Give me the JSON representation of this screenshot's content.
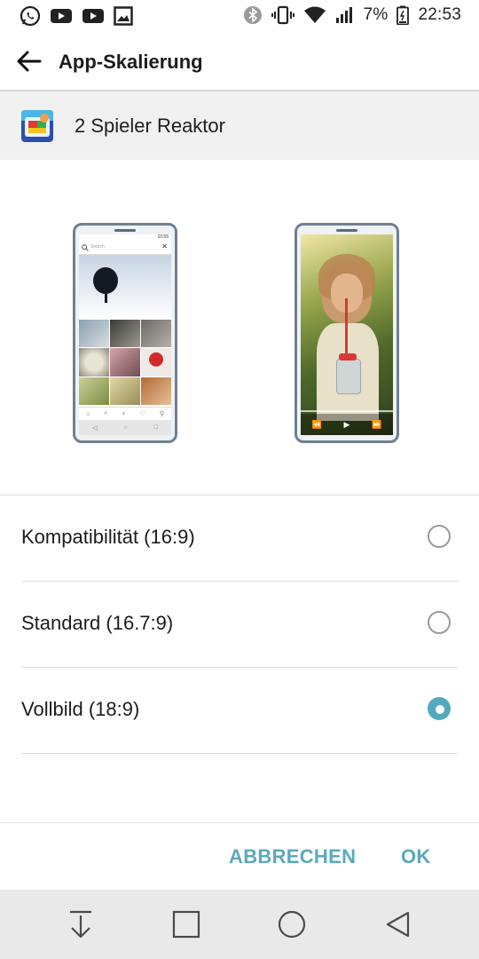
{
  "status_bar": {
    "battery": "7%",
    "time": "22:53",
    "left_icons": [
      "whatsapp-icon",
      "youtube-icon",
      "youtube-icon",
      "gallery-icon"
    ],
    "right_icons": [
      "bluetooth-icon",
      "vibrate-icon",
      "wifi-icon",
      "signal-icon",
      "battery-icon"
    ]
  },
  "header": {
    "title": "App-Skalierung"
  },
  "app": {
    "name": "2 Spieler Reaktor"
  },
  "previews": {
    "left_phone": {
      "clock": "10:55",
      "search_placeholder": "Search"
    }
  },
  "options": [
    {
      "label": "Kompatibilität (16:9)",
      "selected": false
    },
    {
      "label": "Standard (16.7:9)",
      "selected": false
    },
    {
      "label": "Vollbild (18:9)",
      "selected": true
    }
  ],
  "buttons": {
    "cancel": "ABBRECHEN",
    "ok": "OK"
  },
  "colors": {
    "accent": "#53a9bd",
    "app_row_bg": "#f1f1f1",
    "nav_bg": "#e9e9e9"
  }
}
